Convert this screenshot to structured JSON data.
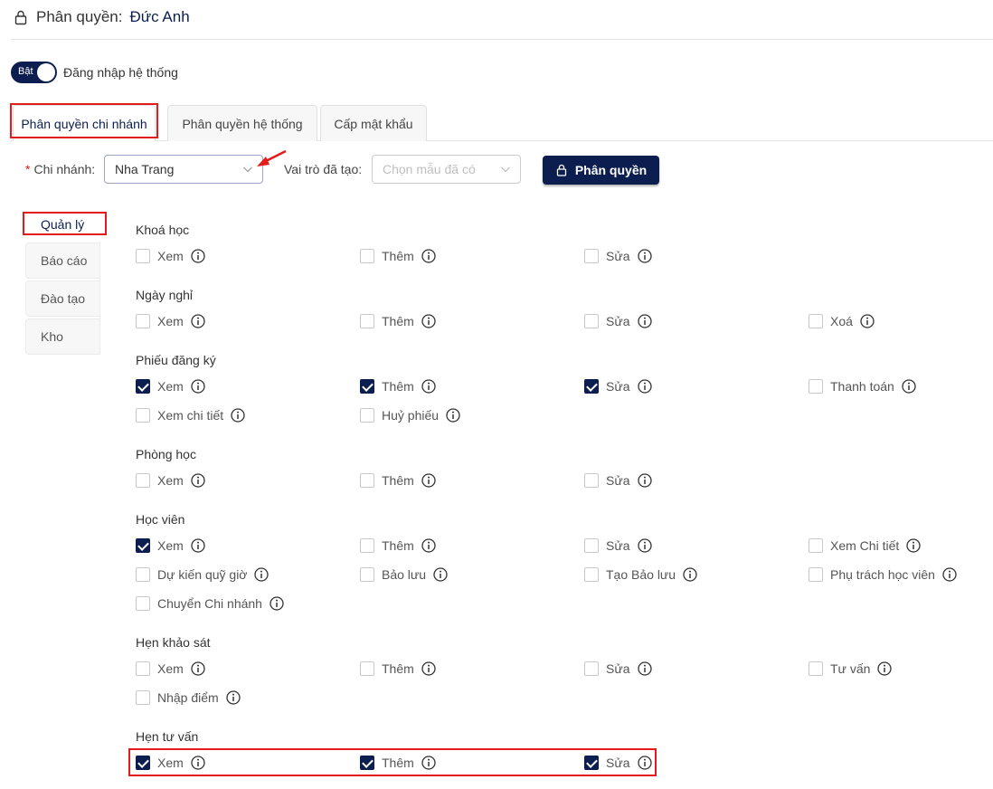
{
  "header": {
    "label": "Phân quyền:",
    "name": "Đức Anh",
    "icon": "lock-icon"
  },
  "login": {
    "switch_text": "Bật",
    "label": "Đăng nhập hệ thống",
    "on": true
  },
  "tabs": [
    {
      "label": "Phân quyền chi nhánh",
      "active": true
    },
    {
      "label": "Phân quyền hệ thống",
      "active": false
    },
    {
      "label": "Cấp mật khẩu",
      "active": false
    }
  ],
  "filters": {
    "required_mark": "*",
    "branch_label": "Chi nhánh:",
    "branch_value": "Nha Trang",
    "role_label": "Vai trò đã tạo:",
    "role_placeholder": "Chọn mẫu đã có",
    "button_label": "Phân quyền"
  },
  "sidenav": [
    {
      "label": "Quản lý",
      "active": true
    },
    {
      "label": "Báo cáo",
      "active": false
    },
    {
      "label": "Đào tạo",
      "active": false
    },
    {
      "label": "Kho",
      "active": false
    }
  ],
  "groups": [
    {
      "title": "Khoá học",
      "items": [
        {
          "label": "Xem",
          "checked": false
        },
        {
          "label": "Thêm",
          "checked": false
        },
        {
          "label": "Sửa",
          "checked": false
        }
      ]
    },
    {
      "title": "Ngày nghỉ",
      "items": [
        {
          "label": "Xem",
          "checked": false
        },
        {
          "label": "Thêm",
          "checked": false
        },
        {
          "label": "Sửa",
          "checked": false
        },
        {
          "label": "Xoá",
          "checked": false
        }
      ]
    },
    {
      "title": "Phiếu đăng ký",
      "items": [
        {
          "label": "Xem",
          "checked": true
        },
        {
          "label": "Thêm",
          "checked": true
        },
        {
          "label": "Sửa",
          "checked": true
        },
        {
          "label": "Thanh toán",
          "checked": false
        },
        {
          "label": "Xem chi tiết",
          "checked": false
        },
        {
          "label": "Huỷ phiếu",
          "checked": false
        }
      ]
    },
    {
      "title": "Phòng học",
      "items": [
        {
          "label": "Xem",
          "checked": false
        },
        {
          "label": "Thêm",
          "checked": false
        },
        {
          "label": "Sửa",
          "checked": false
        }
      ]
    },
    {
      "title": "Học viên",
      "items": [
        {
          "label": "Xem",
          "checked": true
        },
        {
          "label": "Thêm",
          "checked": false
        },
        {
          "label": "Sửa",
          "checked": false
        },
        {
          "label": "Xem Chi tiết",
          "checked": false
        },
        {
          "label": "Dự kiến quỹ giờ",
          "checked": false
        },
        {
          "label": "Bảo lưu",
          "checked": false
        },
        {
          "label": "Tạo Bảo lưu",
          "checked": false
        },
        {
          "label": "Phụ trách học viên",
          "checked": false
        },
        {
          "label": "Chuyển Chi nhánh",
          "checked": false
        }
      ]
    },
    {
      "title": "Hẹn khảo sát",
      "items": [
        {
          "label": "Xem",
          "checked": false
        },
        {
          "label": "Thêm",
          "checked": false
        },
        {
          "label": "Sửa",
          "checked": false
        },
        {
          "label": "Tư vấn",
          "checked": false
        },
        {
          "label": "Nhập điểm",
          "checked": false
        }
      ]
    },
    {
      "title": "Hẹn tư vấn",
      "items": [
        {
          "label": "Xem",
          "checked": true
        },
        {
          "label": "Thêm",
          "checked": true
        },
        {
          "label": "Sửa",
          "checked": true
        }
      ]
    }
  ]
}
